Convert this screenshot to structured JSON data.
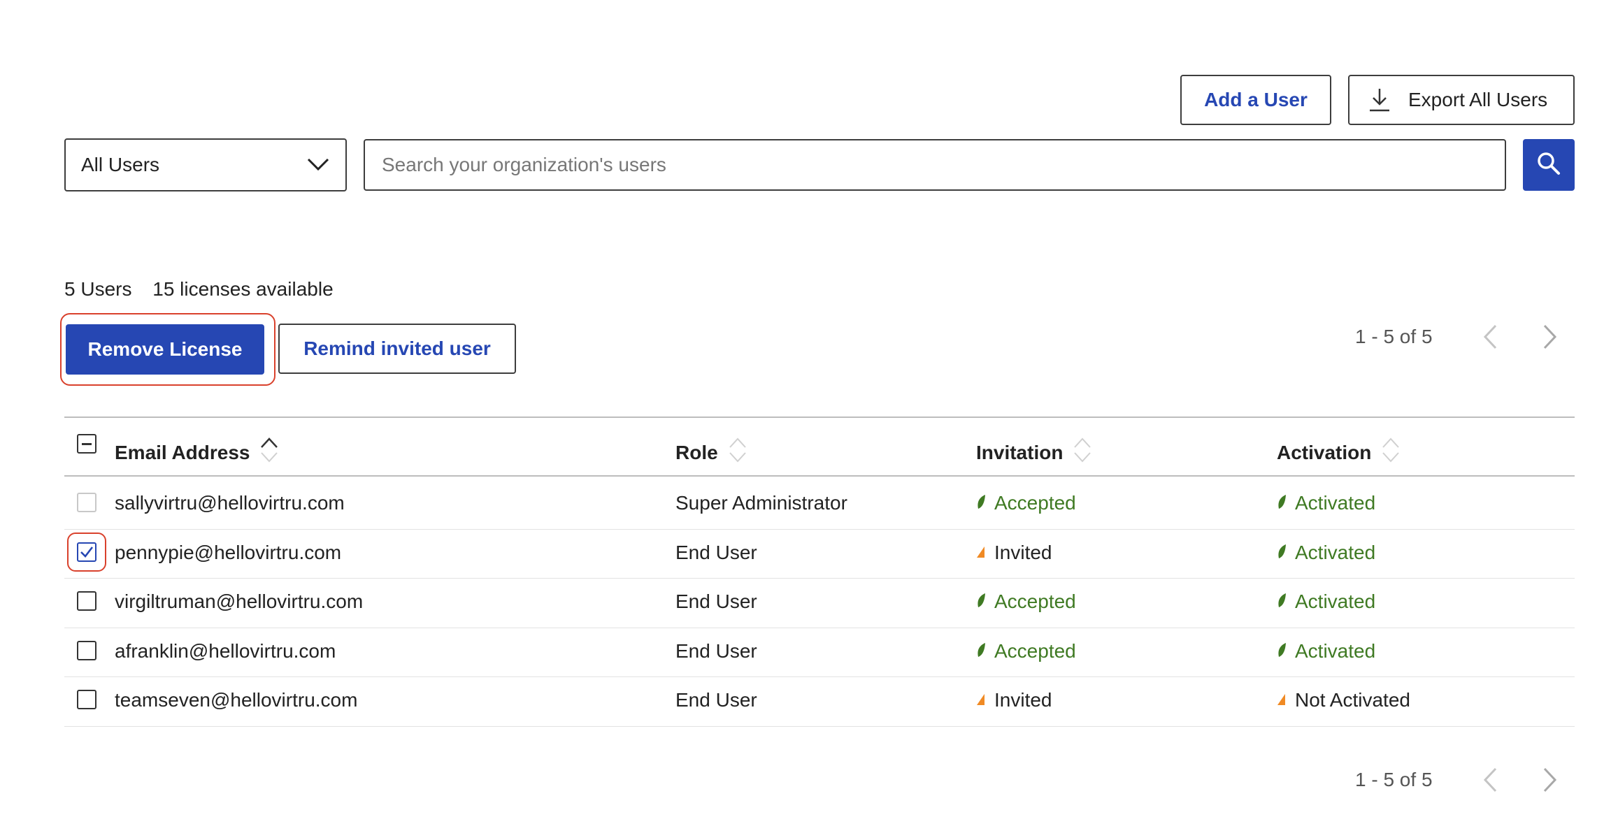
{
  "toolbar": {
    "add_user_label": "Add a User",
    "export_label": "Export All Users"
  },
  "filter": {
    "selected": "All Users",
    "search_placeholder": "Search your organization's users"
  },
  "summary": {
    "users_count": "5 Users",
    "licenses": "15 licenses available"
  },
  "actions": {
    "remove_license": "Remove License",
    "remind_invited": "Remind invited user"
  },
  "pagination": {
    "top": "1 - 5  of  5",
    "bottom": "1 - 5  of  5"
  },
  "table": {
    "headers": {
      "email": "Email Address",
      "role": "Role",
      "invitation": "Invitation",
      "activation": "Activation"
    },
    "rows": [
      {
        "email": "sallyvirtru@hellovirtru.com",
        "role": "Super Administrator",
        "invitation": "Accepted",
        "activation": "Activated",
        "checked": false,
        "disabled": true
      },
      {
        "email": "pennypie@hellovirtru.com",
        "role": "End User",
        "invitation": "Invited",
        "activation": "Activated",
        "checked": true,
        "disabled": false
      },
      {
        "email": "virgiltruman@hellovirtru.com",
        "role": "End User",
        "invitation": "Accepted",
        "activation": "Activated",
        "checked": false,
        "disabled": false
      },
      {
        "email": "afranklin@hellovirtru.com",
        "role": "End User",
        "invitation": "Accepted",
        "activation": "Activated",
        "checked": false,
        "disabled": false
      },
      {
        "email": "teamseven@hellovirtru.com",
        "role": "End User",
        "invitation": "Invited",
        "activation": "Not Activated",
        "checked": false,
        "disabled": false
      }
    ]
  },
  "colors": {
    "primary": "#2647b3",
    "success": "#3f7a23",
    "pending": "#f08a24",
    "highlight": "#d9412c"
  }
}
